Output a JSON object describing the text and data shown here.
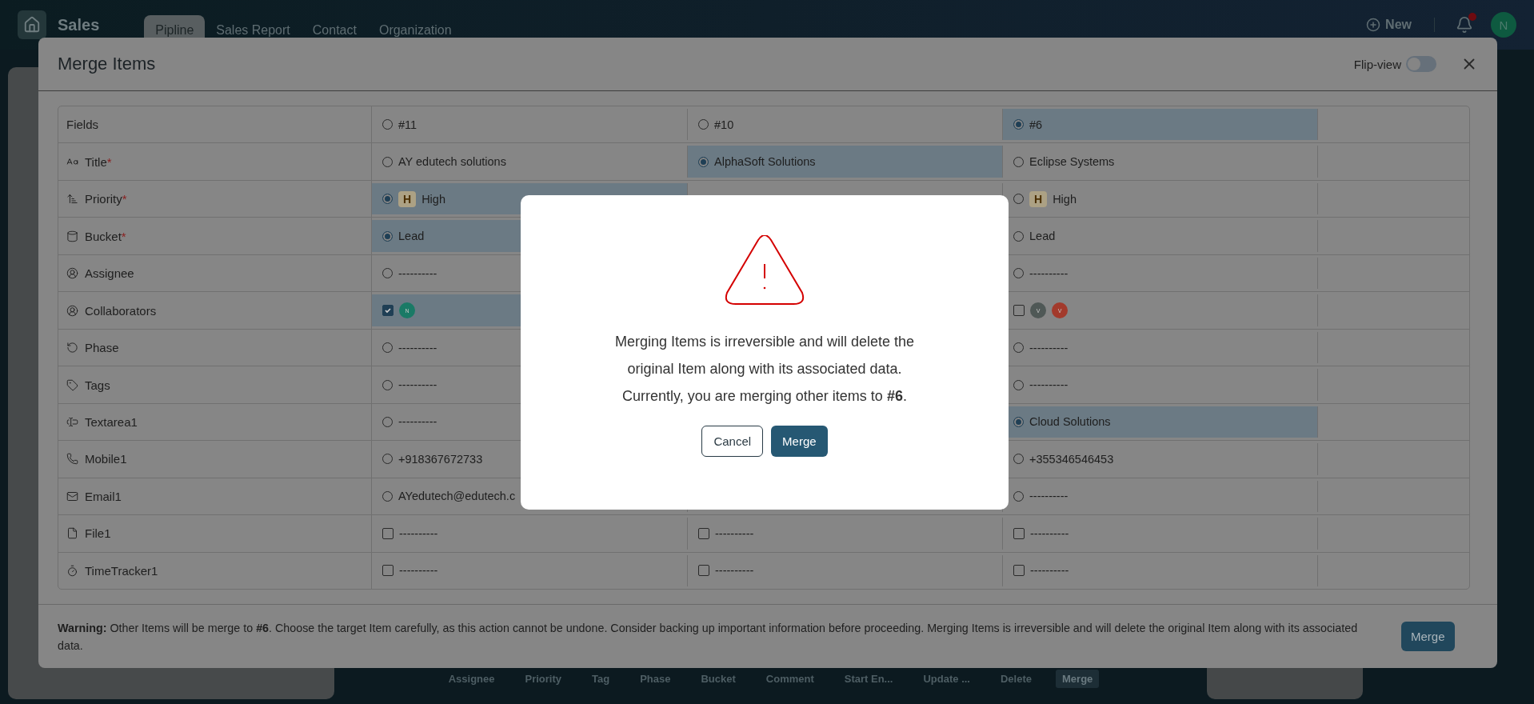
{
  "app_header": {
    "title": "Sales",
    "tabs": [
      {
        "label": "Pipline",
        "selected": true
      },
      {
        "label": "Sales Report",
        "selected": false
      },
      {
        "label": "Contact",
        "selected": false
      },
      {
        "label": "Organization",
        "selected": false
      }
    ],
    "new_button": "New",
    "notification_dot": true,
    "avatar": "N"
  },
  "merge_modal": {
    "title": "Merge Items",
    "flip_view": {
      "label": "Flip-view",
      "on": false
    },
    "header_label": "Fields",
    "columns": [
      {
        "label": "#11",
        "selected": false
      },
      {
        "label": "#10",
        "selected": false
      },
      {
        "label": "#6",
        "selected": true
      }
    ],
    "rows": [
      {
        "field": "Title",
        "required_mark": "*",
        "kind": "radio",
        "cells": [
          {
            "value": "AY edutech solutions",
            "selected": false
          },
          {
            "value": "AlphaSoft Solutions",
            "selected": true
          },
          {
            "value": "Eclipse Systems",
            "selected": false
          }
        ]
      },
      {
        "field": "Priority",
        "required_mark": "*",
        "kind": "radio",
        "cells": [
          {
            "badge": "H",
            "value": "High",
            "selected": true
          },
          null,
          {
            "badge": "H",
            "value": "High",
            "selected": false
          }
        ]
      },
      {
        "field": "Bucket",
        "required_mark": "*",
        "kind": "radio",
        "cells": [
          {
            "value": "Lead",
            "selected": true
          },
          null,
          {
            "value": "Lead",
            "selected": false
          }
        ]
      },
      {
        "field": "Assignee",
        "kind": "radio",
        "cells": [
          {
            "value": "----------",
            "selected": false
          },
          null,
          {
            "value": "----------",
            "selected": false
          }
        ]
      },
      {
        "field": "Collaborators",
        "kind": "avatars",
        "cells": [
          {
            "checked": true,
            "avatars": [
              {
                "letter": "N",
                "color": "#1a7a66"
              }
            ]
          },
          null,
          {
            "checked": false,
            "avatars": [
              {
                "letter": "V",
                "color": "#4f5856"
              },
              {
                "letter": "V",
                "color": "#a23a2c"
              }
            ]
          }
        ]
      },
      {
        "field": "Phase",
        "kind": "radio",
        "cells": [
          {
            "value": "----------",
            "selected": false
          },
          null,
          {
            "value": "----------",
            "selected": false
          }
        ]
      },
      {
        "field": "Tags",
        "kind": "radio",
        "cells": [
          {
            "value": "----------",
            "selected": false
          },
          null,
          {
            "value": "----------",
            "selected": false
          }
        ]
      },
      {
        "field": "Textarea1",
        "kind": "radio",
        "cells": [
          {
            "value": "----------",
            "selected": false
          },
          null,
          {
            "value": "Cloud Solutions",
            "selected": true
          }
        ]
      },
      {
        "field": "Mobile1",
        "kind": "radio",
        "cells": [
          {
            "value": "+918367672733",
            "selected": false
          },
          null,
          {
            "value": "+355346546453",
            "selected": false
          }
        ]
      },
      {
        "field": "Email1",
        "kind": "radio",
        "cells": [
          {
            "value": "AYedutech@edutech.c",
            "selected": false
          },
          null,
          {
            "value": "----------",
            "selected": false
          }
        ]
      },
      {
        "field": "File1",
        "kind": "checkbox",
        "cells": [
          {
            "value": "----------",
            "checked": false
          },
          {
            "value": "----------",
            "checked": false
          },
          {
            "value": "----------",
            "checked": false
          }
        ]
      },
      {
        "field": "TimeTracker1",
        "kind": "checkbox",
        "cells": [
          {
            "value": "----------",
            "checked": false
          },
          {
            "value": "----------",
            "checked": false
          },
          {
            "value": "----------",
            "checked": false
          }
        ]
      }
    ],
    "warning": "**Warning:** Other Items will be merge to **#6**. Choose the target Item carefully, as this action cannot be undone. Consider backing up important information before proceeding. Merging Items is irreversible and will delete the original Item along with its associated data.",
    "merge_button": "Merge"
  },
  "confirm_dialog": {
    "message": "Merging Items is irreversible and will delete the original Item along with its associated data. Currently, you are merging other items to **#6**.",
    "cancel_button": "Cancel",
    "confirm_button": "Merge"
  },
  "bottom_toolbar": [
    {
      "label": "Assignee",
      "selected": false
    },
    {
      "label": "Priority",
      "selected": false
    },
    {
      "label": "Tag",
      "selected": false
    },
    {
      "label": "Phase",
      "selected": false
    },
    {
      "label": "Bucket",
      "selected": false
    },
    {
      "label": "Comment",
      "selected": false
    },
    {
      "label": "Start En...",
      "selected": false
    },
    {
      "label": "Update ...",
      "selected": false
    },
    {
      "label": "Delete",
      "selected": false
    },
    {
      "label": "Merge",
      "selected": true
    }
  ]
}
